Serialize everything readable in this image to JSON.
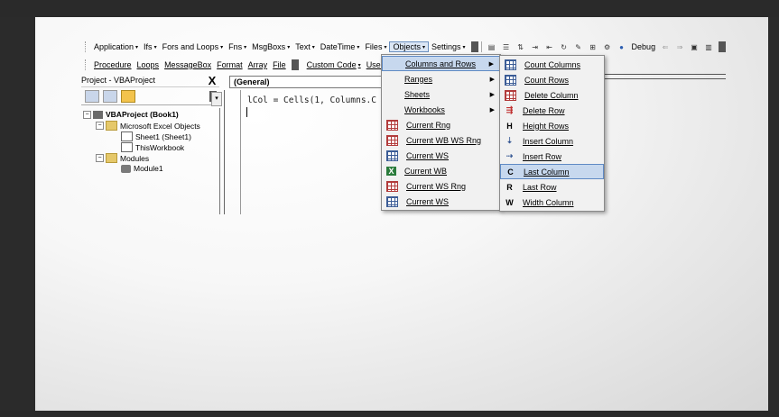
{
  "toolbar1": {
    "menus": [
      "Application",
      "Ifs",
      "Fors and Loops",
      "Fns",
      "MsgBoxs",
      "Text",
      "DateTime",
      "Files",
      "Objects",
      "Settings"
    ],
    "debug_label": "Debug"
  },
  "toolbar2": {
    "items": [
      "Procedure",
      "Loops",
      "MessageBox",
      "Format",
      "Array",
      "File"
    ],
    "custom_code": "Custom Code",
    "user_folder": "User Fold"
  },
  "project": {
    "title": "Project - VBAProject",
    "close": "X",
    "tree": {
      "root": "VBAProject (Book1)",
      "excel_objects": "Microsoft Excel Objects",
      "sheet1": "Sheet1 (Sheet1)",
      "workbook": "ThisWorkbook",
      "modules": "Modules",
      "module1": "Module1"
    }
  },
  "code": {
    "general": "(General)",
    "line1": "lCol = Cells(1, Columns.C"
  },
  "objects_menu": {
    "items": [
      {
        "label": "Columns and Rows",
        "submenu": true
      },
      {
        "label": "Ranges",
        "submenu": true
      },
      {
        "label": "Sheets",
        "submenu": true
      },
      {
        "label": "Workbooks",
        "submenu": true
      },
      {
        "label": "Current Rng",
        "submenu": false
      },
      {
        "label": "Current WB WS Rng",
        "submenu": false
      },
      {
        "label": "Current WS",
        "submenu": false
      },
      {
        "label": "Current WB",
        "submenu": false
      },
      {
        "label": "Current WS Rng",
        "submenu": false
      },
      {
        "label": "Current WS",
        "submenu": false
      }
    ]
  },
  "colrow_menu": {
    "items": [
      {
        "label": "Count Columns",
        "icon": "grid-columns-icon"
      },
      {
        "label": "Count Rows",
        "icon": "grid-rows-icon"
      },
      {
        "label": "Delete Column",
        "icon": "delete-column-icon"
      },
      {
        "label": "Delete Row",
        "icon": "delete-row-icon"
      },
      {
        "label": "Height Rows",
        "icon_text": "H"
      },
      {
        "label": "Insert Column",
        "icon": "insert-column-icon"
      },
      {
        "label": "Insert Row",
        "icon": "insert-row-icon"
      },
      {
        "label": "Last Column",
        "icon_text": "C"
      },
      {
        "label": "Last Row",
        "icon_text": "R"
      },
      {
        "label": "Width Column",
        "icon_text": "W"
      }
    ]
  },
  "colors": {
    "menu_highlight": "#c7d8ee",
    "highlight_border": "#5f8ac4"
  }
}
